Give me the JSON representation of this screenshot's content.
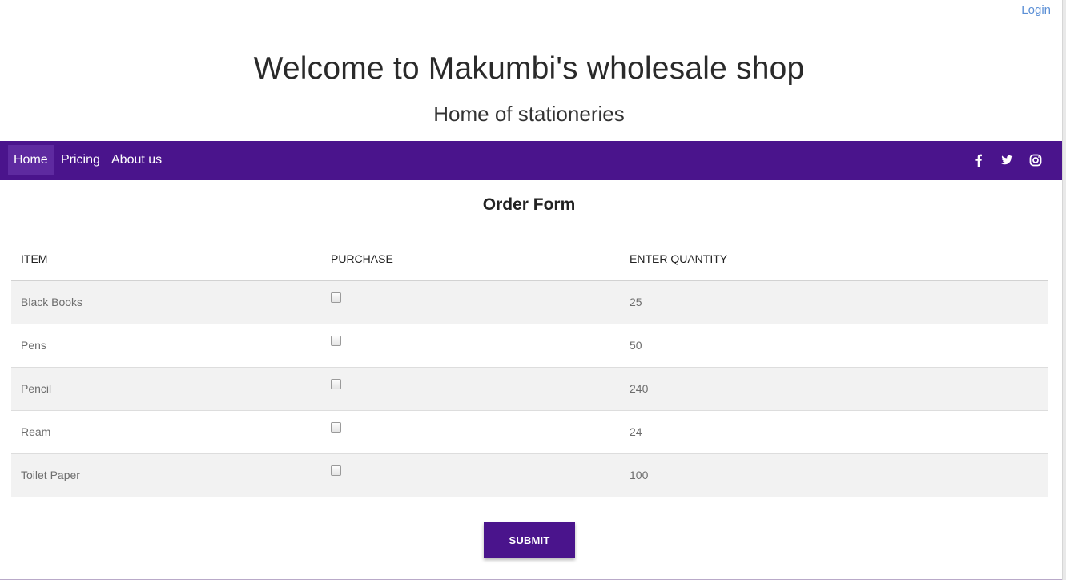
{
  "header": {
    "login_label": "Login",
    "title": "Welcome to Makumbi's wholesale shop",
    "subtitle": "Home of stationeries"
  },
  "nav": {
    "items": [
      {
        "label": "Home",
        "active": true
      },
      {
        "label": "Pricing",
        "active": false
      },
      {
        "label": "About us",
        "active": false
      }
    ],
    "social_icons": [
      "facebook-icon",
      "twitter-icon",
      "instagram-icon"
    ],
    "background_color": "#4a148c"
  },
  "order_form": {
    "heading": "Order Form",
    "columns": [
      "ITEM",
      "PURCHASE",
      "ENTER QUANTITY"
    ],
    "rows": [
      {
        "item": "Black Books",
        "purchase": false,
        "quantity": "25"
      },
      {
        "item": "Pens",
        "purchase": false,
        "quantity": "50"
      },
      {
        "item": "Pencil",
        "purchase": false,
        "quantity": "240"
      },
      {
        "item": "Ream",
        "purchase": false,
        "quantity": "24"
      },
      {
        "item": "Toilet Paper",
        "purchase": false,
        "quantity": "100"
      }
    ],
    "submit_label": "SUBMIT"
  },
  "colors": {
    "accent": "#4a148c",
    "link": "#5b8fd6",
    "striped_row": "#f2f2f2"
  }
}
